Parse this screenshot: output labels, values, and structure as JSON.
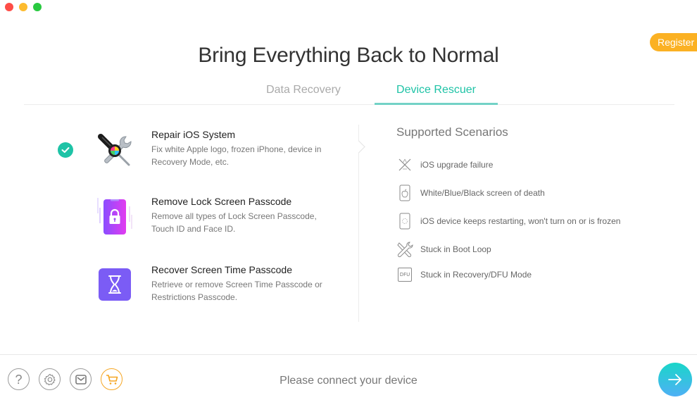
{
  "window": {
    "controls": [
      "close",
      "minimize",
      "maximize"
    ]
  },
  "header": {
    "register_label": "Register",
    "title": "Bring Everything Back to Normal"
  },
  "tabs": [
    {
      "label": "Data Recovery",
      "active": false
    },
    {
      "label": "Device Rescuer",
      "active": true
    }
  ],
  "features": [
    {
      "name": "Repair iOS System",
      "description": "Fix white Apple logo, frozen iPhone, device in Recovery Mode, etc.",
      "icon": "repair-tools-icon",
      "selected": true
    },
    {
      "name": "Remove Lock Screen Passcode",
      "description": "Remove all types of Lock Screen Passcode, Touch ID and Face ID.",
      "icon": "lock-phone-icon",
      "selected": false
    },
    {
      "name": "Recover Screen Time Passcode",
      "description": "Retrieve or remove Screen Time Passcode or Restrictions Passcode.",
      "icon": "hourglass-icon",
      "selected": false
    }
  ],
  "scenarios": {
    "title": "Supported Scenarios",
    "items": [
      {
        "label": "iOS upgrade failure",
        "icon": "upgrade-failure-icon"
      },
      {
        "label": "White/Blue/Black screen of death",
        "icon": "apple-screen-icon"
      },
      {
        "label": "iOS device keeps restarting, won't turn on or is frozen",
        "icon": "restart-device-icon"
      },
      {
        "label": "Stuck in Boot Loop",
        "icon": "tools-icon"
      },
      {
        "label": "Stuck in Recovery/DFU Mode",
        "icon": "dfu-icon",
        "icon_text": "DFU"
      }
    ]
  },
  "footer": {
    "buttons": [
      "help",
      "settings",
      "feedback",
      "store"
    ],
    "status": "Please connect your device"
  },
  "colors": {
    "accent": "#1ec3a6",
    "register": "#fbb123",
    "cart": "#f5a623"
  }
}
